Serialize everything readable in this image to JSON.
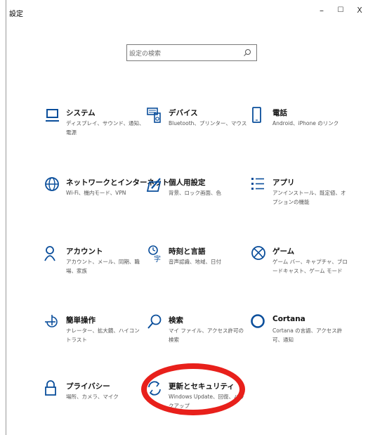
{
  "window": {
    "title": "設定",
    "minimize_label": "–",
    "maximize_label": "☐",
    "close_label": "X"
  },
  "search": {
    "placeholder": "設定の検索"
  },
  "items": [
    {
      "key": "system",
      "title": "システム",
      "desc": "ディスプレイ、サウンド、通知、電源",
      "icon": "monitor-icon"
    },
    {
      "key": "devices",
      "title": "デバイス",
      "desc": "Bluetooth、プリンター、マウス",
      "icon": "keyboard-speaker-icon"
    },
    {
      "key": "phone",
      "title": "電話",
      "desc": "Android、iPhone のリンク",
      "icon": "phone-icon"
    },
    {
      "key": "network",
      "title": "ネットワークとインターネット",
      "desc": "Wi-Fi、機内モード、VPN",
      "icon": "globe-icon"
    },
    {
      "key": "personalization",
      "title": "個人用設定",
      "desc": "背景、ロック画面、色",
      "icon": "paint-tablet-icon"
    },
    {
      "key": "apps",
      "title": "アプリ",
      "desc": "アンインストール、既定値、オプションの機能",
      "icon": "apps-list-icon"
    },
    {
      "key": "accounts",
      "title": "アカウント",
      "desc": "アカウント、メール、同期、職場、家族",
      "icon": "person-icon"
    },
    {
      "key": "time-language",
      "title": "時刻と言語",
      "desc": "音声認識、地域、日付",
      "icon": "time-language-icon"
    },
    {
      "key": "gaming",
      "title": "ゲーム",
      "desc": "ゲーム バー、キャプチャ、ブロードキャスト、ゲーム モード",
      "icon": "xbox-icon"
    },
    {
      "key": "ease-of-access",
      "title": "簡単操作",
      "desc": "ナレーター、拡大鏡、ハイコントラスト",
      "icon": "ease-of-access-icon"
    },
    {
      "key": "search",
      "title": "検索",
      "desc": "マイ ファイル、アクセス許可の検索",
      "icon": "search-icon"
    },
    {
      "key": "cortana",
      "title": "Cortana",
      "desc": "Cortana の言語、アクセス許可、通知",
      "icon": "cortana-icon"
    },
    {
      "key": "privacy",
      "title": "プライバシー",
      "desc": "場所、カメラ、マイク",
      "icon": "lock-icon"
    },
    {
      "key": "update-security",
      "title": "更新とセキュリティ",
      "desc": "Windows Update、回復、バックアップ",
      "icon": "refresh-icon"
    }
  ],
  "annotation": {
    "color": "#e8201b"
  }
}
